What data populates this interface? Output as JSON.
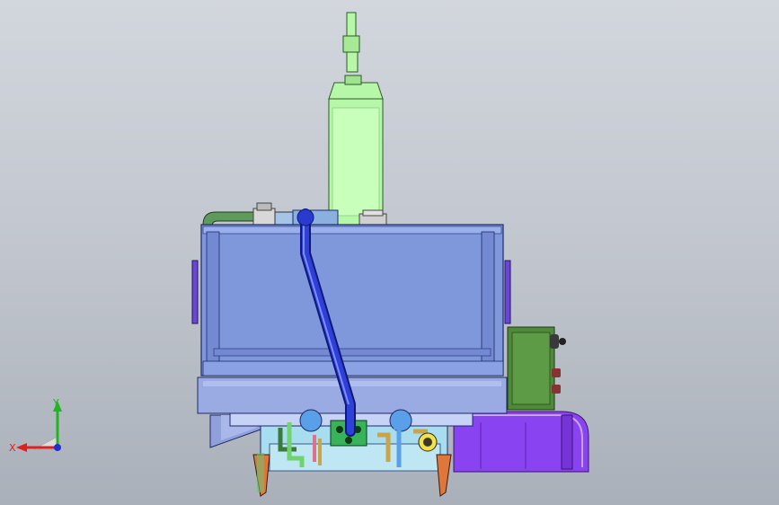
{
  "viewport": {
    "background_top": "#d2d6dd",
    "background_bottom": "#aab0b9"
  },
  "triad": {
    "x_label": "X",
    "y_label": "Y",
    "x_color": "#e02020",
    "y_color": "#22b522",
    "z_color": "#2030d0"
  },
  "colors": {
    "tank_body": "#7f98dc",
    "tank_outline": "#1f2a66",
    "filter_green": "#b6f7a8",
    "hose_blue": "#1f2fc4",
    "pipe_green": "#5f9a5c",
    "frame_purple": "#8a43f0",
    "box_olive": "#4e8a3a",
    "base_slab": "#9aaae2"
  }
}
